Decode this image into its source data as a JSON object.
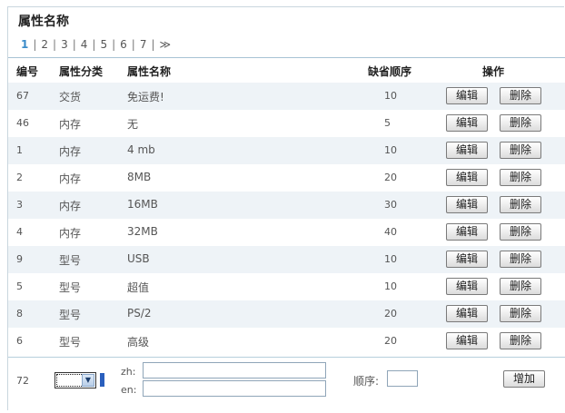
{
  "title": "属性名称",
  "pager": {
    "pages": [
      "1",
      "2",
      "3",
      "4",
      "5",
      "6",
      "7"
    ],
    "next": "≫",
    "current": "1"
  },
  "headers": {
    "id": "编号",
    "category": "属性分类",
    "name": "属性名称",
    "order": "缺省顺序",
    "actions": "操作"
  },
  "rows": [
    {
      "id": "67",
      "category": "交货",
      "name": "免运费!",
      "order": "10"
    },
    {
      "id": "46",
      "category": "内存",
      "name": "无",
      "order": "5"
    },
    {
      "id": "1",
      "category": "内存",
      "name": "4 mb",
      "order": "10"
    },
    {
      "id": "2",
      "category": "内存",
      "name": "8MB",
      "order": "20"
    },
    {
      "id": "3",
      "category": "内存",
      "name": "16MB",
      "order": "30"
    },
    {
      "id": "4",
      "category": "内存",
      "name": "32MB",
      "order": "40"
    },
    {
      "id": "9",
      "category": "型号",
      "name": "USB",
      "order": "10"
    },
    {
      "id": "5",
      "category": "型号",
      "name": "超值",
      "order": "10"
    },
    {
      "id": "8",
      "category": "型号",
      "name": "PS/2",
      "order": "20"
    },
    {
      "id": "6",
      "category": "型号",
      "name": "高级",
      "order": "20"
    }
  ],
  "buttons": {
    "edit": "编辑",
    "delete": "删除",
    "add": "增加"
  },
  "form": {
    "next_id": "72",
    "zh_label": "zh:",
    "en_label": "en:",
    "order_label": "顺序:",
    "zh_value": "",
    "en_value": "",
    "order_value": ""
  },
  "colors": {
    "accent": "#3a8bc9",
    "row_alt": "#eef3f7",
    "border": "#c9d6de"
  }
}
